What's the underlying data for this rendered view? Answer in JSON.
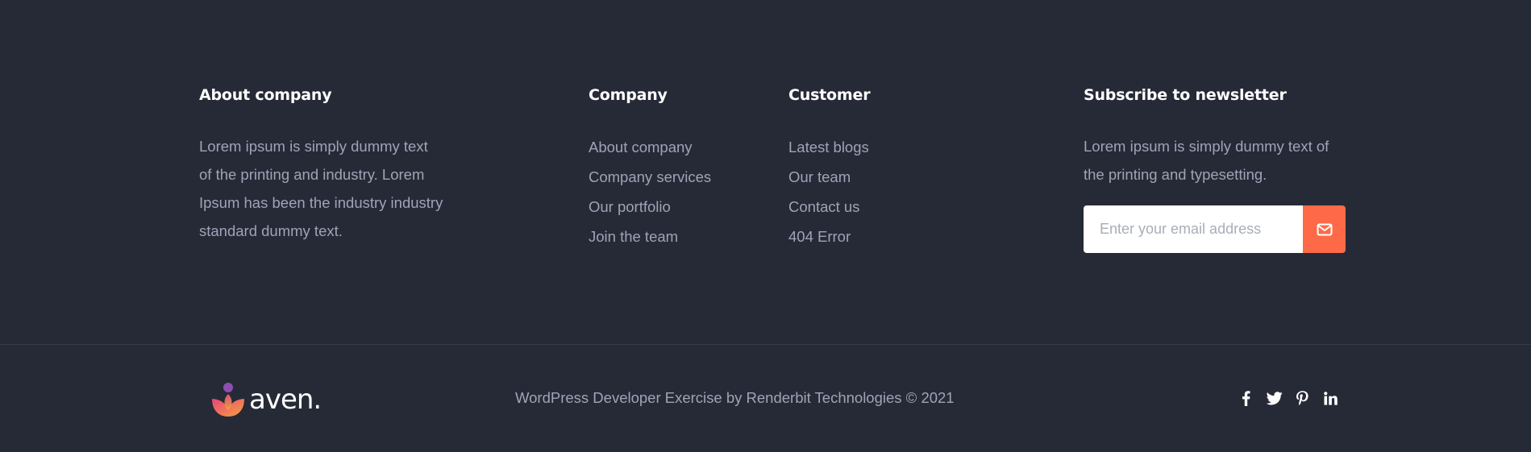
{
  "about": {
    "heading": "About company",
    "text_lines": [
      "Lorem ipsum is simply dummy text",
      "of the printing and industry. Lorem",
      "Ipsum has been the industry industry",
      "standard dummy text."
    ]
  },
  "company": {
    "heading": "Company",
    "links": [
      "About company",
      "Company services",
      "Our portfolio",
      "Join the team"
    ]
  },
  "customer": {
    "heading": "Customer",
    "links": [
      "Latest blogs",
      "Our team",
      "Contact us",
      "404 Error"
    ]
  },
  "newsletter": {
    "heading": "Subscribe to newsletter",
    "text_lines": [
      "Lorem ipsum is simply dummy text of",
      "the printing and typesetting."
    ],
    "email_placeholder": "Enter your email address",
    "email_value": "",
    "submit_icon": "envelope-icon"
  },
  "bottom": {
    "logo_text": "aven.",
    "copyright": "WordPress Developer Exercise by Renderbit Technologies © 2021",
    "social_icons": [
      "facebook-icon",
      "twitter-icon",
      "pinterest-icon",
      "linkedin-icon"
    ]
  },
  "colors": {
    "background": "#262a36",
    "text_muted": "#9ea4b8",
    "heading": "#ffffff",
    "accent": "#fe6a48",
    "divider": "#363a47"
  }
}
